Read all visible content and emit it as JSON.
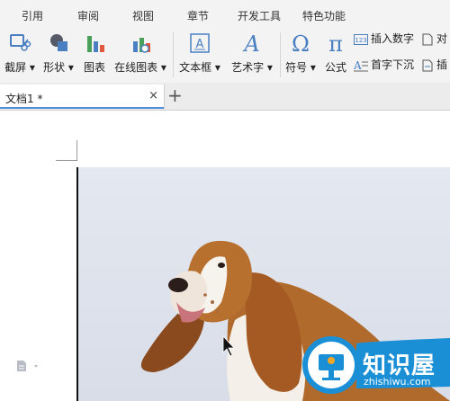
{
  "menu": [
    "引用",
    "审阅",
    "视图",
    "章节",
    "开发工具",
    "特色功能"
  ],
  "ribbon": {
    "screenshot": "截屏",
    "shapes": "形状",
    "chart": "图表",
    "online_chart": "在线图表",
    "textbox": "文本框",
    "wordart": "艺术字",
    "symbol": "符号",
    "formula": "公式",
    "insert_number": "插入数字",
    "drop_cap": "首字下沉",
    "object_partial": "对",
    "insert_partial": "插"
  },
  "document_tab": {
    "name": "文档1 *",
    "close": "×",
    "new_tab": "+"
  },
  "watermark": {
    "name": "知识屋",
    "url": "zhishiwu.com"
  },
  "colors": {
    "accent": "#4a90d9",
    "watermark_blue": "#1a8fd6",
    "watermark_orange": "#f5a623"
  }
}
